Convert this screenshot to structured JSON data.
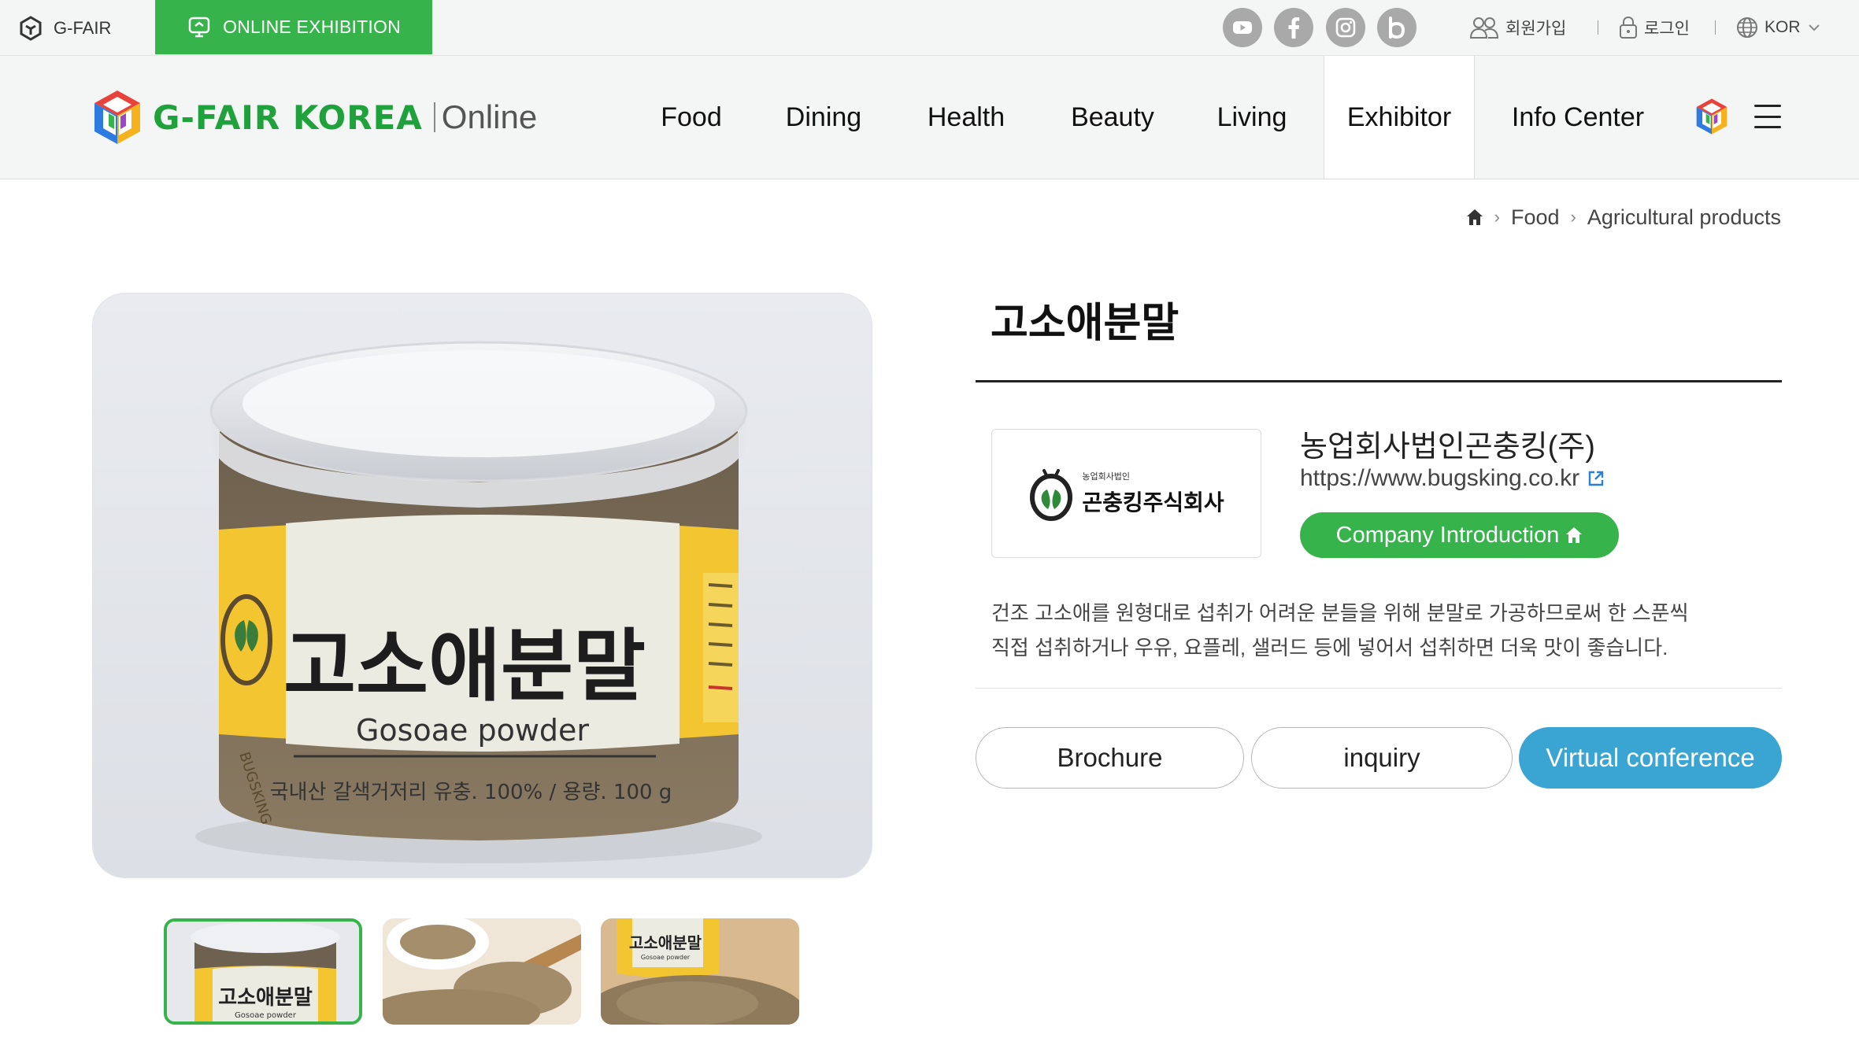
{
  "topbar": {
    "gfair_label": "G-FAIR",
    "online_exhibition_label": "ONLINE EXHIBITION",
    "social_icons": [
      "youtube-icon",
      "facebook-icon",
      "instagram-icon",
      "blog-icon"
    ],
    "signup_label": "회원가입",
    "login_label": "로그인",
    "language": "KOR"
  },
  "nav": {
    "logo_text": "G-FAIR KOREA",
    "logo_suffix": "Online",
    "items": [
      "Food",
      "Dining",
      "Health",
      "Beauty",
      "Living",
      "Exhibitor",
      "Info Center"
    ],
    "active_item": "Exhibitor"
  },
  "breadcrumb": {
    "home_icon": "home-icon",
    "items": [
      "Food",
      "Agricultural products"
    ]
  },
  "product": {
    "title": "고소애분말",
    "image_label_kr": "고소애분말",
    "image_label_en": "Gosoae powder",
    "image_label_sub": "국내산 갈색거저리 유충. 100% / 용량. 100 g",
    "image_brand": "BUGSKING",
    "thumbnails": [
      {
        "label": "고소애분말",
        "sub": "Gosoae powder"
      },
      {
        "label": "",
        "sub": ""
      },
      {
        "label": "고소애분말",
        "sub": "Gosoae powder"
      }
    ],
    "description_lines": [
      "건조 고소애를 원형대로 섭취가 어려운 분들을 위해 분말로 가공하므로써 한 스푼씩",
      "직접 섭취하거나 우유, 요플레, 샐러드 등에 넣어서 섭취하면 더욱 맛이 좋습니다."
    ]
  },
  "company": {
    "logo_small_text": "농업회사법인",
    "logo_text": "곤충킹주식회사",
    "name": "농업회사법인곤충킹(주)",
    "url": "https://www.bugsking.co.kr",
    "intro_button": "Company Introduction"
  },
  "actions": {
    "brochure": "Brochure",
    "inquiry": "inquiry",
    "virtual_conference": "Virtual conference"
  },
  "colors": {
    "brand_green": "#36b34a",
    "accent_blue": "#3aa4d2",
    "topbar_bg": "#f4f5f5",
    "social_grey": "#a9a9a9"
  }
}
